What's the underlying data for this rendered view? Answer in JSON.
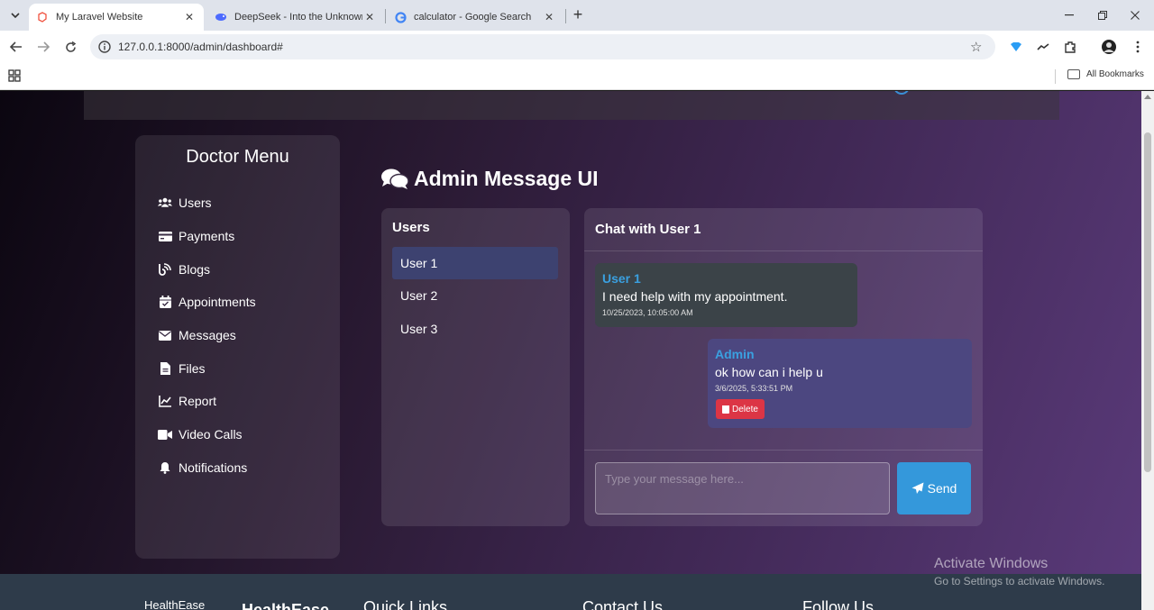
{
  "browser": {
    "tabs": [
      {
        "title": "My Laravel Website",
        "active": true,
        "icon": "laravel-icon"
      },
      {
        "title": "DeepSeek - Into the Unknown",
        "active": false,
        "icon": "deepseek-icon"
      },
      {
        "title": "calculator - Google Search",
        "active": false,
        "icon": "google-icon"
      }
    ],
    "url": "127.0.0.1:8000/admin/dashboard#",
    "bookmarks_label": "All Bookmarks"
  },
  "sidebar": {
    "title": "Doctor Menu",
    "items": [
      {
        "label": "Users",
        "icon": "users-icon"
      },
      {
        "label": "Payments",
        "icon": "credit-card-icon"
      },
      {
        "label": "Blogs",
        "icon": "blog-icon"
      },
      {
        "label": "Appointments",
        "icon": "calendar-icon"
      },
      {
        "label": "Messages",
        "icon": "envelope-icon"
      },
      {
        "label": "Files",
        "icon": "file-icon"
      },
      {
        "label": "Report",
        "icon": "chart-line-icon"
      },
      {
        "label": "Video Calls",
        "icon": "video-icon"
      },
      {
        "label": "Notifications",
        "icon": "bell-icon"
      }
    ]
  },
  "main": {
    "title": "Admin Message UI",
    "users_panel": {
      "heading": "Users",
      "users": [
        "User 1",
        "User 2",
        "User 3"
      ],
      "selected": "User 1"
    },
    "chat": {
      "heading": "Chat with User 1",
      "messages": [
        {
          "sender": "User 1",
          "text": "I need help with my appointment.",
          "time": "10/25/2023, 10:05:00 AM"
        },
        {
          "sender": "Admin",
          "text": "ok how can i help u",
          "time": "3/6/2025, 5:33:51 PM",
          "delete_label": "Delete"
        }
      ],
      "input_placeholder": "Type your message here...",
      "send_label": "Send"
    }
  },
  "footer": {
    "logo_alt": "HealthEase",
    "brand": "HealthEase",
    "quick_links": "Quick Links",
    "contact": "Contact Us",
    "follow": "Follow Us"
  },
  "watermark": {
    "line1": "Activate Windows",
    "line2": "Go to Settings to activate Windows."
  },
  "colors": {
    "accent": "#3498db",
    "sender_name": "#3aa0e0",
    "delete": "#dc3545",
    "active_user": "#3d4270"
  }
}
